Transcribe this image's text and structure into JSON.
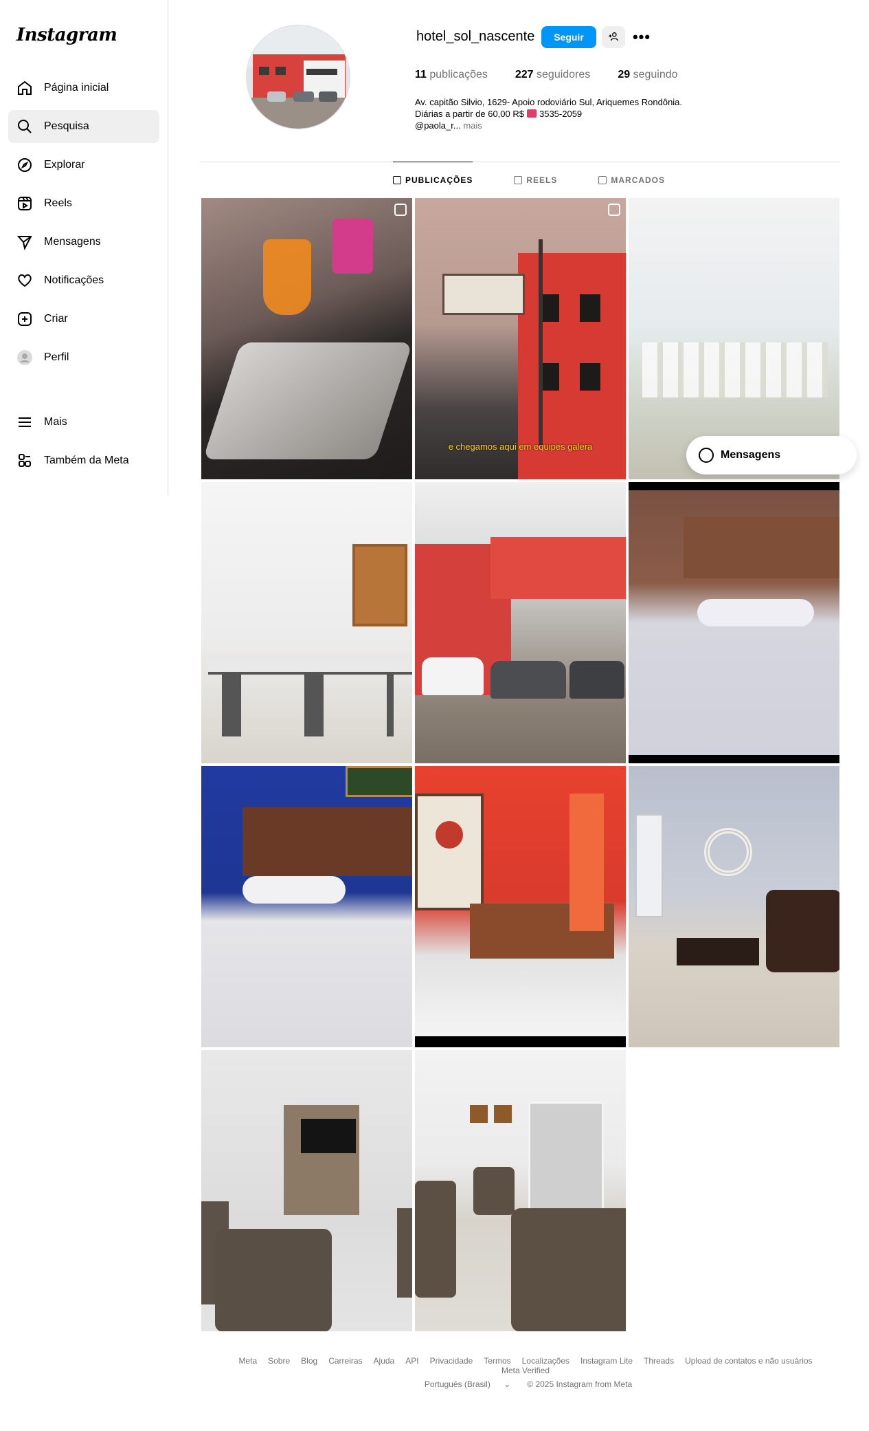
{
  "app": {
    "logo_text": "Instagram"
  },
  "sidebar": {
    "items": [
      {
        "label": "Página inicial",
        "icon": "home-icon"
      },
      {
        "label": "Pesquisa",
        "icon": "search-icon",
        "active": true
      },
      {
        "label": "Explorar",
        "icon": "compass-icon"
      },
      {
        "label": "Reels",
        "icon": "reels-icon"
      },
      {
        "label": "Mensagens",
        "icon": "paper-plane-icon"
      },
      {
        "label": "Notificações",
        "icon": "heart-icon"
      },
      {
        "label": "Criar",
        "icon": "plus-square-icon"
      },
      {
        "label": "Perfil",
        "icon": "avatar-icon"
      }
    ],
    "bottom_items": [
      {
        "label": "Mais",
        "icon": "menu-icon"
      },
      {
        "label": "Também da Meta",
        "icon": "meta-apps-icon"
      }
    ]
  },
  "profile": {
    "username": "hotel_sol_nascente",
    "follow_label": "Seguir",
    "stats": {
      "posts_count": "11",
      "posts_label": "publicações",
      "followers_count": "227",
      "followers_label": "seguidores",
      "following_count": "29",
      "following_label": "seguindo"
    },
    "bio_line1": "Av. capitão Silvio, 1629- Apoio rodoviário Sul, Ariquemes Rondônia.",
    "bio_line2_prefix": "Diárias a partir de 60,00 R$",
    "bio_line2_phone": "3535-2059",
    "bio_handle": "@paola_r...",
    "bio_more": "mais"
  },
  "tabs": [
    {
      "label": "PUBLICAÇÕES",
      "active": true
    },
    {
      "label": "REELS",
      "active": false
    },
    {
      "label": "MARCADOS",
      "active": false
    }
  ],
  "posts": [
    {
      "type": "reel",
      "subject": "breakfast-tray"
    },
    {
      "type": "reel",
      "subject": "hotel-facade-sign",
      "caption": "e chegamos aqui em equipes galera"
    },
    {
      "type": "image",
      "subject": "dining-hall"
    },
    {
      "type": "image",
      "subject": "breakfast-buffet"
    },
    {
      "type": "image",
      "subject": "hotel-building-parking"
    },
    {
      "type": "image",
      "subject": "twin-bed-room"
    },
    {
      "type": "image",
      "subject": "double-bed-blue-wall"
    },
    {
      "type": "image",
      "subject": "double-bed-red-wall"
    },
    {
      "type": "image",
      "subject": "lobby-sofa"
    },
    {
      "type": "image",
      "subject": "tv-lounge"
    },
    {
      "type": "image",
      "subject": "reception-lounge"
    }
  ],
  "messages_bar": {
    "label": "Mensagens"
  },
  "footer": {
    "links": [
      "Meta",
      "Sobre",
      "Blog",
      "Carreiras",
      "Ajuda",
      "API",
      "Privacidade",
      "Termos",
      "Localizações",
      "Instagram Lite",
      "Threads",
      "Upload de contatos e não usuários",
      "Meta Verified"
    ],
    "language": "Português (Brasil)",
    "copyright": "© 2025 Instagram from Meta"
  },
  "colors": {
    "accent": "#0095f6",
    "muted": "#737373",
    "border": "#dbdbdb"
  }
}
